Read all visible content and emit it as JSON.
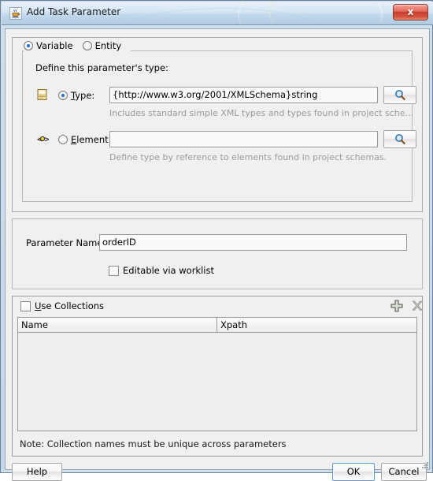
{
  "window": {
    "title": "Add Task Parameter",
    "title_icon": "java-coffee-cup-icon",
    "close_label": "x"
  },
  "kind_group": {
    "options": [
      {
        "label": "Variable",
        "selected": true
      },
      {
        "label": "Entity",
        "selected": false
      }
    ]
  },
  "define_panel": {
    "heading": "Define this parameter's type:",
    "type_row": {
      "icon": "xml-type-document-icon",
      "radio_label": "Type:",
      "selected": true,
      "value": "{http://www.w3.org/2001/XMLSchema}string",
      "browse_icon": "search-magnifier-icon",
      "hint": "Includes standard simple XML types and types found in project sche…"
    },
    "element_row": {
      "icon": "xml-element-icon",
      "radio_label": "Element:",
      "selected": false,
      "value": "",
      "browse_icon": "search-magnifier-icon",
      "hint": "Define type by reference to elements found in project schemas."
    }
  },
  "parameter_panel": {
    "name_label": "Parameter Name:",
    "name_value": "orderID",
    "editable_checkbox": {
      "label": "Editable via worklist",
      "checked": false
    }
  },
  "collections_panel": {
    "use_collections": {
      "label": "Use Collections",
      "checked": false
    },
    "add_icon": "plus-add-icon",
    "delete_icon": "delete-cross-icon",
    "table": {
      "columns": [
        "Name",
        "Xpath"
      ],
      "rows": []
    },
    "note": "Note: Collection names must be unique across parameters"
  },
  "buttons": {
    "help": "Help",
    "ok": "OK",
    "cancel": "Cancel"
  },
  "colors": {
    "titlebar_top": "#e7f0f8",
    "titlebar_bottom": "#c3d9ec",
    "close_red": "#c63d2c",
    "panel_bg": "#f0f0f0",
    "field_bg": "#fafafa",
    "focus_blue": "#5b9bd5",
    "radio_dot": "#1c6fd0",
    "hint_gray": "#9a9a9a"
  }
}
